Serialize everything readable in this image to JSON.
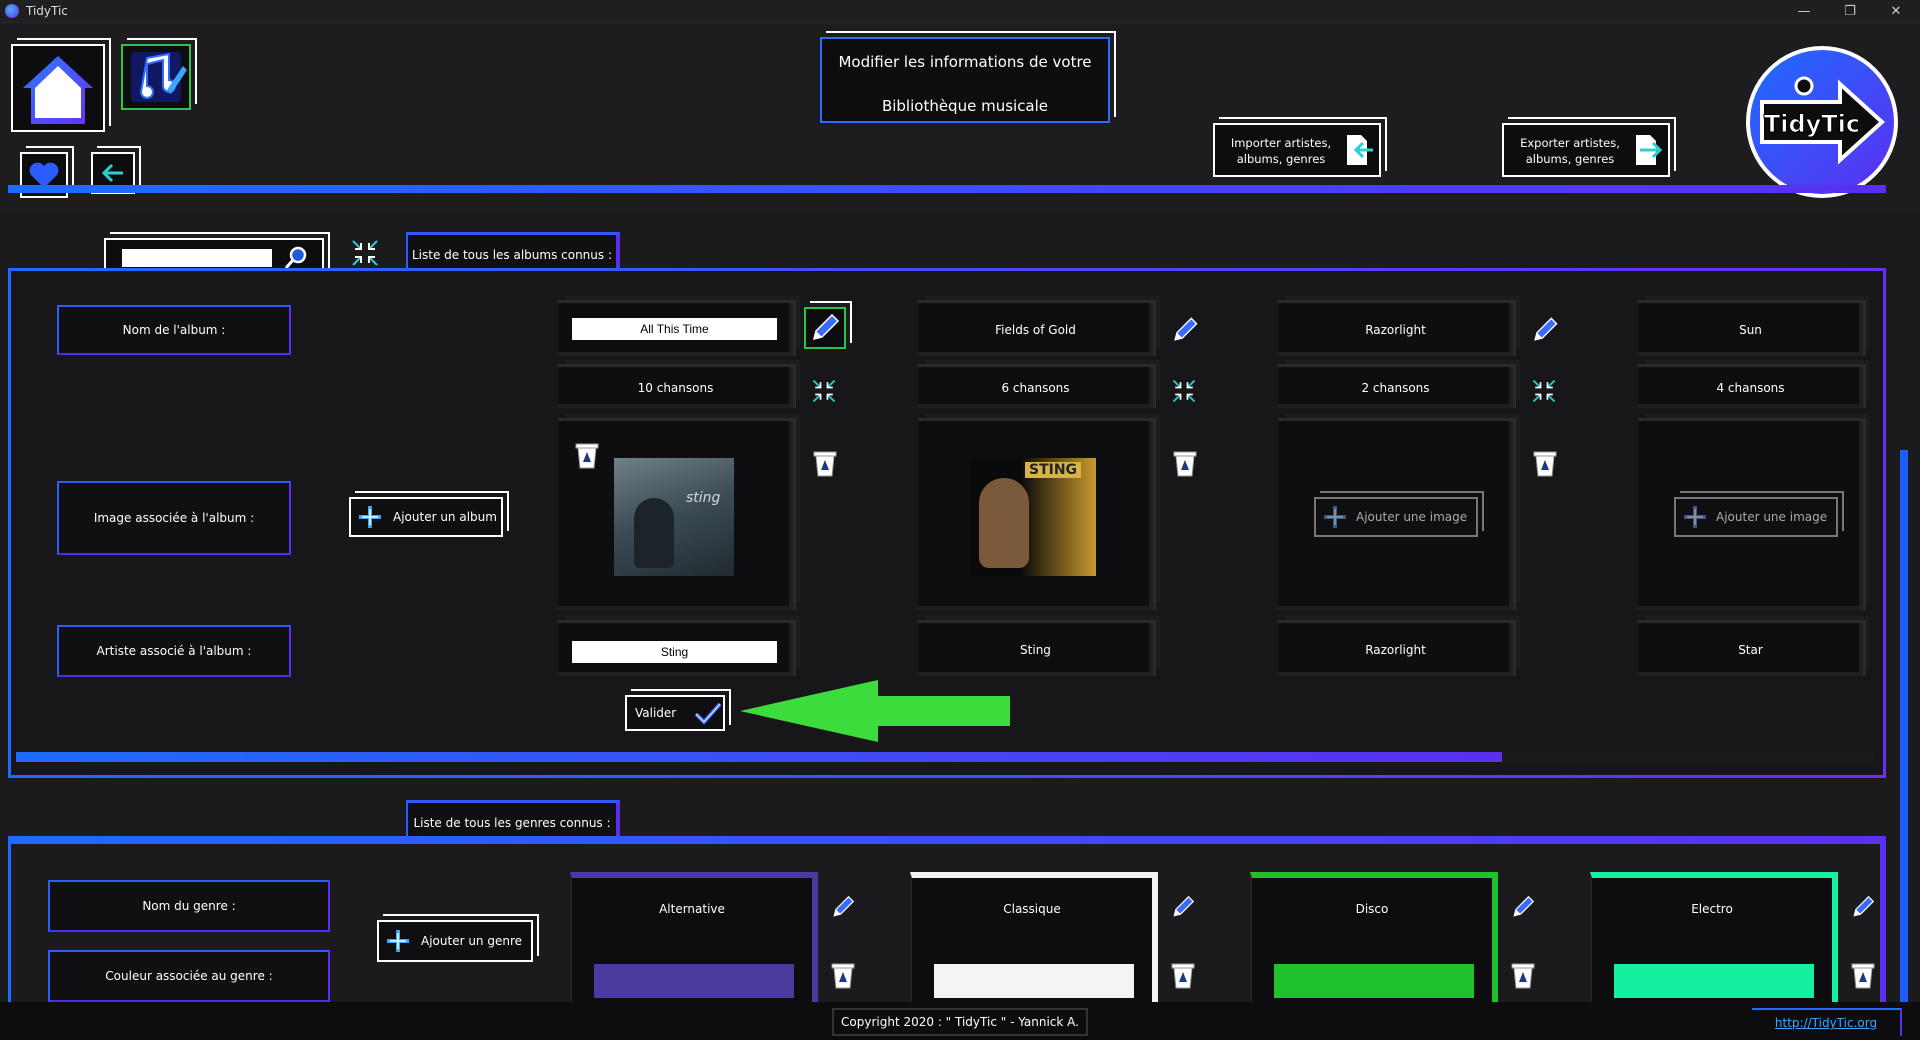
{
  "window": {
    "title": "TidyTic",
    "minimize": "—",
    "restore": "❐",
    "close": "✕"
  },
  "header": {
    "title_line1": "Modifier les informations de votre",
    "title_line2": "Bibliothèque musicale",
    "import_label": "Importer artistes,\nalbums, genres",
    "export_label": "Exporter artistes,\nalbums, genres",
    "logo_text": "TidyTic"
  },
  "search": {
    "value": "",
    "placeholder": ""
  },
  "albums_section": {
    "tab_label": "Liste de tous les albums connus :",
    "row_labels": {
      "name": "Nom de l'album :",
      "image": "Image associée à l'album :",
      "artist": "Artiste associé à l'album :"
    },
    "add_album_label": "Ajouter un album",
    "validate_label": "Valider",
    "add_image_label": "Ajouter une image",
    "albums": [
      {
        "name": "All This Time",
        "songs": "10 chansons",
        "artist": "Sting",
        "editing": true,
        "has_image": true
      },
      {
        "name": "Fields of Gold",
        "songs": "6 chansons",
        "artist": "Sting",
        "editing": false,
        "has_image": true
      },
      {
        "name": "Razorlight",
        "songs": "2 chansons",
        "artist": "Razorlight",
        "editing": false,
        "has_image": false
      },
      {
        "name": "Sun",
        "songs": "4 chansons",
        "artist": "Star",
        "editing": false,
        "has_image": false
      }
    ],
    "album_art_1_text": "STING",
    "album_art_0_text": "sting",
    "scroll_fraction": 0.8
  },
  "genres_section": {
    "tab_label": "Liste de tous les genres connus :",
    "row_labels": {
      "name": "Nom du genre :",
      "color": "Couleur associée au genre :"
    },
    "add_genre_label": "Ajouter un genre",
    "genres": [
      {
        "name": "Alternative",
        "color": "#4b3a9e"
      },
      {
        "name": "Classique",
        "color": "#f4f4f4"
      },
      {
        "name": "Disco",
        "color": "#1fc22a"
      },
      {
        "name": "Electro",
        "color": "#14f0a0"
      }
    ]
  },
  "footer": {
    "copyright": "Copyright 2020 : \" TidyTic \" - Yannick A.",
    "link": "http://TidyTic.org"
  },
  "colors": {
    "accent_blue": "#1e6cff",
    "accent_purple": "#5b2ff0",
    "arrow_green": "#3ddc3d"
  }
}
